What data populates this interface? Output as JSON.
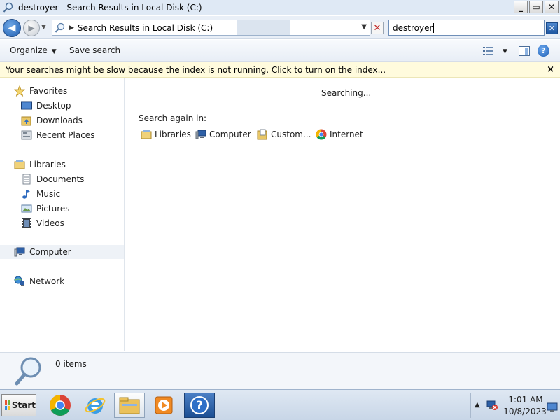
{
  "window": {
    "title": "destroyer - Search Results in Local Disk (C:)",
    "minimize_label": "_",
    "maximize_label": "▭",
    "close_label": "✕"
  },
  "addressbar": {
    "breadcrumb": "Search Results in Local Disk (C:)",
    "search_value": "destroyer"
  },
  "commandbar": {
    "organize": "Organize",
    "save_search": "Save search"
  },
  "infobar": {
    "message": "Your searches might be slow because the index is not running.  Click to turn on the index...",
    "close": "×"
  },
  "navigation": {
    "favorites": "Favorites",
    "desktop": "Desktop",
    "downloads": "Downloads",
    "recent_places": "Recent Places",
    "libraries": "Libraries",
    "documents": "Documents",
    "music": "Music",
    "pictures": "Pictures",
    "videos": "Videos",
    "computer": "Computer",
    "network": "Network"
  },
  "content": {
    "status": "Searching...",
    "search_again_label": "Search again in:",
    "search_again": {
      "libraries": "Libraries",
      "computer": "Computer",
      "custom": "Custom...",
      "internet": "Internet"
    }
  },
  "details": {
    "count": "0 items"
  },
  "taskbar": {
    "start": "Start",
    "time": "1:01 AM",
    "date": "10/8/2023"
  },
  "colors": {
    "accent": "#1f5fb1",
    "infobar_bg": "#fffbdd",
    "title_bg": "#dfe9f5"
  }
}
